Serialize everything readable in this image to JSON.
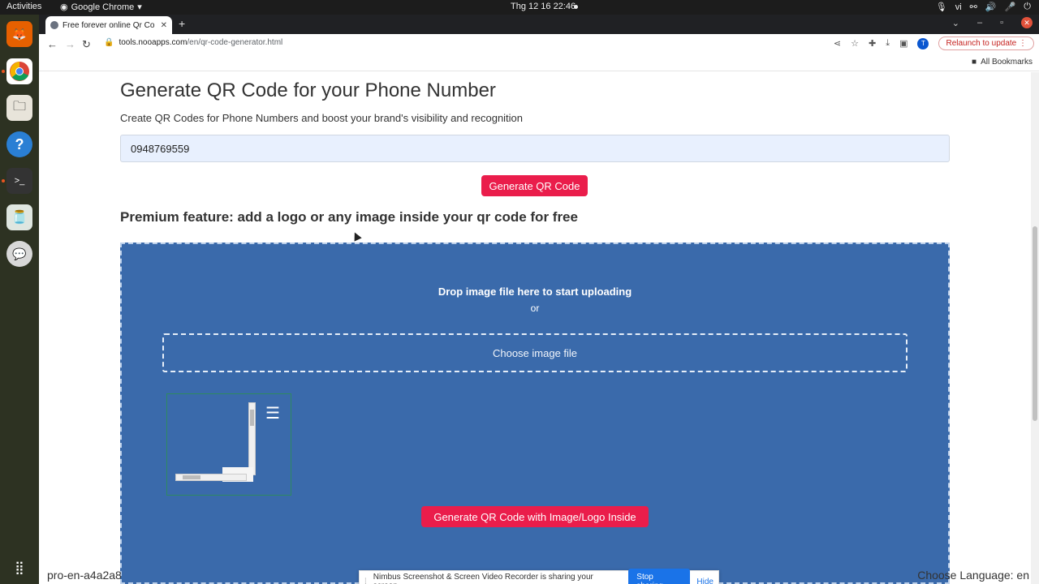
{
  "os": {
    "activities": "Activities",
    "app_name": "Google Chrome",
    "clock": "Thg 12 16  22:46",
    "lang": "vi"
  },
  "browser": {
    "tab_title": "Free forever online Qr Co",
    "url_domain": "tools.nooapps.com",
    "url_path": "/en/qr-code-generator.html",
    "avatar_letter": "T",
    "relaunch": "Relaunch to update",
    "bookmarks_label": "All Bookmarks"
  },
  "page": {
    "title": "Generate QR Code for your Phone Number",
    "subtitle": "Create QR Codes for Phone Numbers and boost your brand's visibility and recognition",
    "phone_value": "0948769559",
    "generate_button": "Generate QR Code",
    "premium_heading": "Premium feature: add a logo or any image inside your qr code for free",
    "drop_title": "Drop image file here to start uploading",
    "drop_or": "or",
    "choose_file": "Choose image file",
    "generate_logo_button": "Generate QR Code with Image/Logo Inside",
    "footer_left": "pro-en-a4a2a8",
    "footer_right": "Choose Language: en"
  },
  "share_bar": {
    "message": "Nimbus Screenshot & Screen Video Recorder is sharing your screen.",
    "stop": "Stop sharing",
    "hide": "Hide"
  },
  "colors": {
    "accent_red": "#ea1d4b",
    "dropzone_blue": "#3a6aab",
    "input_bg": "#e8f0fe"
  }
}
